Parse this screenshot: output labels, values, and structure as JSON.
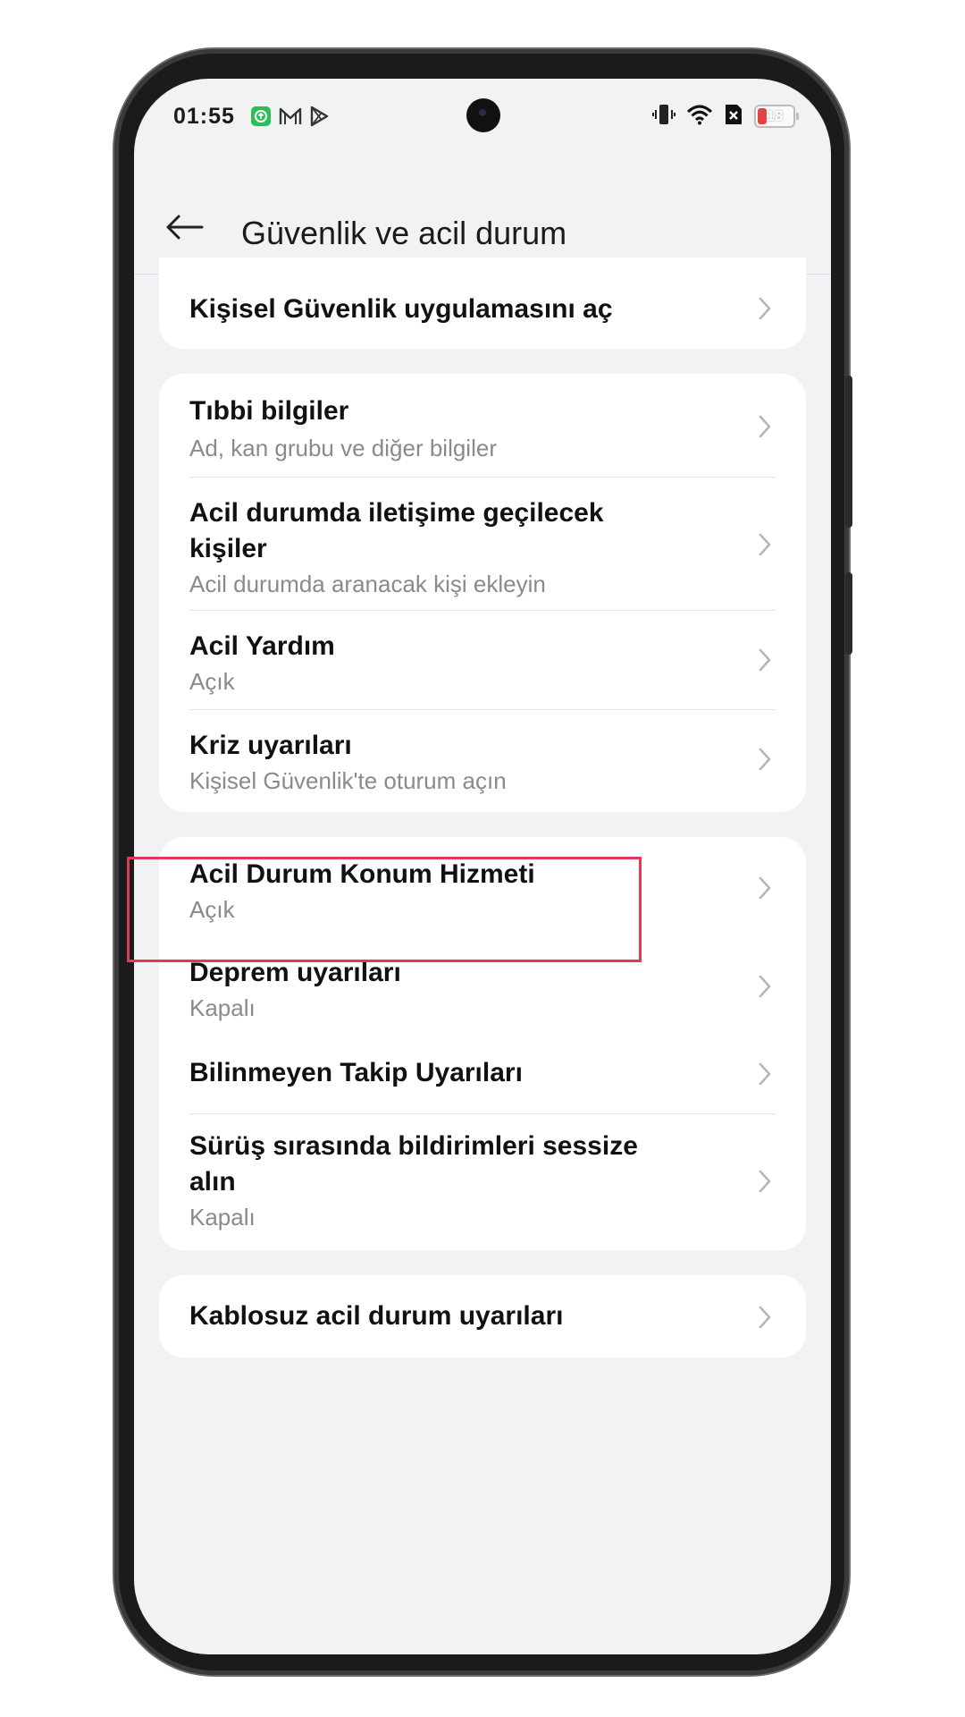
{
  "status_bar": {
    "time": "01:55",
    "battery_level": "18",
    "icons_left": [
      "app-notification-icon",
      "mail-icon",
      "play-icon"
    ],
    "icons_right": [
      "vibrate-icon",
      "wifi-icon",
      "no-sim-icon",
      "battery-icon"
    ]
  },
  "header": {
    "title": "Güvenlik ve acil durum",
    "back_icon": "arrow-left-icon"
  },
  "cards": [
    {
      "rows": [
        {
          "label": "Kişisel Güvenlik uygulamasını aç",
          "sub": ""
        }
      ]
    },
    {
      "rows": [
        {
          "label": "Tıbbi bilgiler",
          "sub": "Ad, kan grubu ve diğer bilgiler"
        },
        {
          "label_line1": "Acil durumda iletişime geçilecek",
          "label_line2": "kişiler",
          "sub": "Acil durumda aranacak kişi ekleyin"
        },
        {
          "label": "Acil Yardım",
          "sub": "Açık"
        },
        {
          "label": "Kriz uyarıları",
          "sub": "Kişisel Güvenlik'te oturum açın"
        }
      ]
    },
    {
      "rows": [
        {
          "label": "Acil Durum Konum Hizmeti",
          "sub": "Açık"
        },
        {
          "label": "Deprem uyarıları",
          "sub": "Kapalı"
        },
        {
          "label": "Bilinmeyen Takip Uyarıları",
          "sub": ""
        },
        {
          "label_line1": "Sürüş sırasında bildirimleri sessize",
          "label_line2": "alın",
          "sub": "Kapalı"
        }
      ]
    },
    {
      "rows": [
        {
          "label": "Kablosuz acil durum uyarıları",
          "sub": ""
        }
      ]
    }
  ],
  "colors": {
    "background": "#f1f2f4",
    "card": "#ffffff",
    "highlight_border": "#e23a56",
    "secondary_text": "#888a8e"
  }
}
